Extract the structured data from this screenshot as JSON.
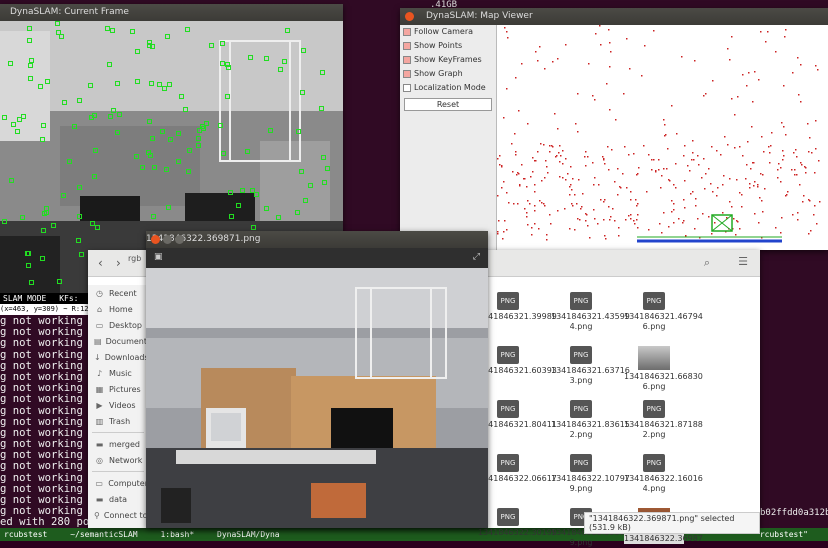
{
  "terminal": {
    "top_text": ".41GB",
    "lines": [
      "g not working becau",
      "g not working becau",
      "g not working becau",
      "g not working becau",
      "g not working becau",
      "g not working becau",
      "g not working becau",
      "g not working becau",
      "g not working becau",
      "g not working becau",
      "g not working becau",
      "g not working becau",
      "g not working becau",
      "g not working becau",
      "g not working becau",
      "g not working becau",
      "g not working becau",
      "g not working becau",
      "ed with 280 points"
    ],
    "hash_text": "b02ffdd0a312ba",
    "statusbar": [
      "rcubstest",
      "~/semanticSLAM",
      "1:bash*",
      "DynaSLAM/Dyna"
    ],
    "statusbar_right": "\"rcubstest\""
  },
  "current_frame": {
    "title": "DynaSLAM: Current Frame",
    "status_mode": "SLAM MODE",
    "status_kfs": "KFs:",
    "coord_label": "(x=463, y=309) ~ R:122 G:"
  },
  "map_viewer": {
    "title": "DynaSLAM: Map Viewer",
    "options": [
      {
        "label": "Follow Camera",
        "checked": true
      },
      {
        "label": "Show Points",
        "checked": true
      },
      {
        "label": "Show KeyFrames",
        "checked": true
      },
      {
        "label": "Show Graph",
        "checked": true
      },
      {
        "label": "Localization Mode",
        "checked": false
      }
    ],
    "reset_label": "Reset"
  },
  "file_manager": {
    "title": "rgb",
    "sidebar": [
      {
        "label": "Recent",
        "icon": "clock-icon"
      },
      {
        "label": "Home",
        "icon": "home-icon"
      },
      {
        "label": "Desktop",
        "icon": "desktop-icon"
      },
      {
        "label": "Documents",
        "icon": "documents-icon"
      },
      {
        "label": "Downloads",
        "icon": "downloads-icon"
      },
      {
        "label": "Music",
        "icon": "music-icon"
      },
      {
        "label": "Pictures",
        "icon": "pictures-icon"
      },
      {
        "label": "Videos",
        "icon": "videos-icon"
      },
      {
        "label": "Trash",
        "icon": "trash-icon"
      },
      {
        "label": "merged",
        "icon": "drive-icon"
      },
      {
        "label": "Network",
        "icon": "network-icon"
      },
      {
        "label": "Computer",
        "icon": "computer-icon"
      },
      {
        "label": "data",
        "icon": "drive-icon"
      },
      {
        "label": "Connect to Server",
        "icon": "server-icon"
      }
    ],
    "files": [
      [
        "1341846321.39989",
        "1341846321.43599\n4.png",
        "1341846321.46794\n6.png"
      ],
      [
        "1341846321.60393",
        "1341846321.63716\n3.png",
        "1341846321.66830\n6.png"
      ],
      [
        "1341846321.80411",
        "1341846321.83615\n2.png",
        "1341846321.87188\n2.png"
      ],
      [
        "1341846322.06617",
        "1341846322.10797\n9.png",
        "1341846322.16016\n4.png"
      ],
      [
        "1341846322.30199",
        "1341846322.33394\n9.png",
        "1341846322.36987"
      ]
    ],
    "selection_status": "\"1341846322.369871.png\" selected (531.9 kB)"
  },
  "image_viewer": {
    "title": "1341846322.369871.png"
  }
}
